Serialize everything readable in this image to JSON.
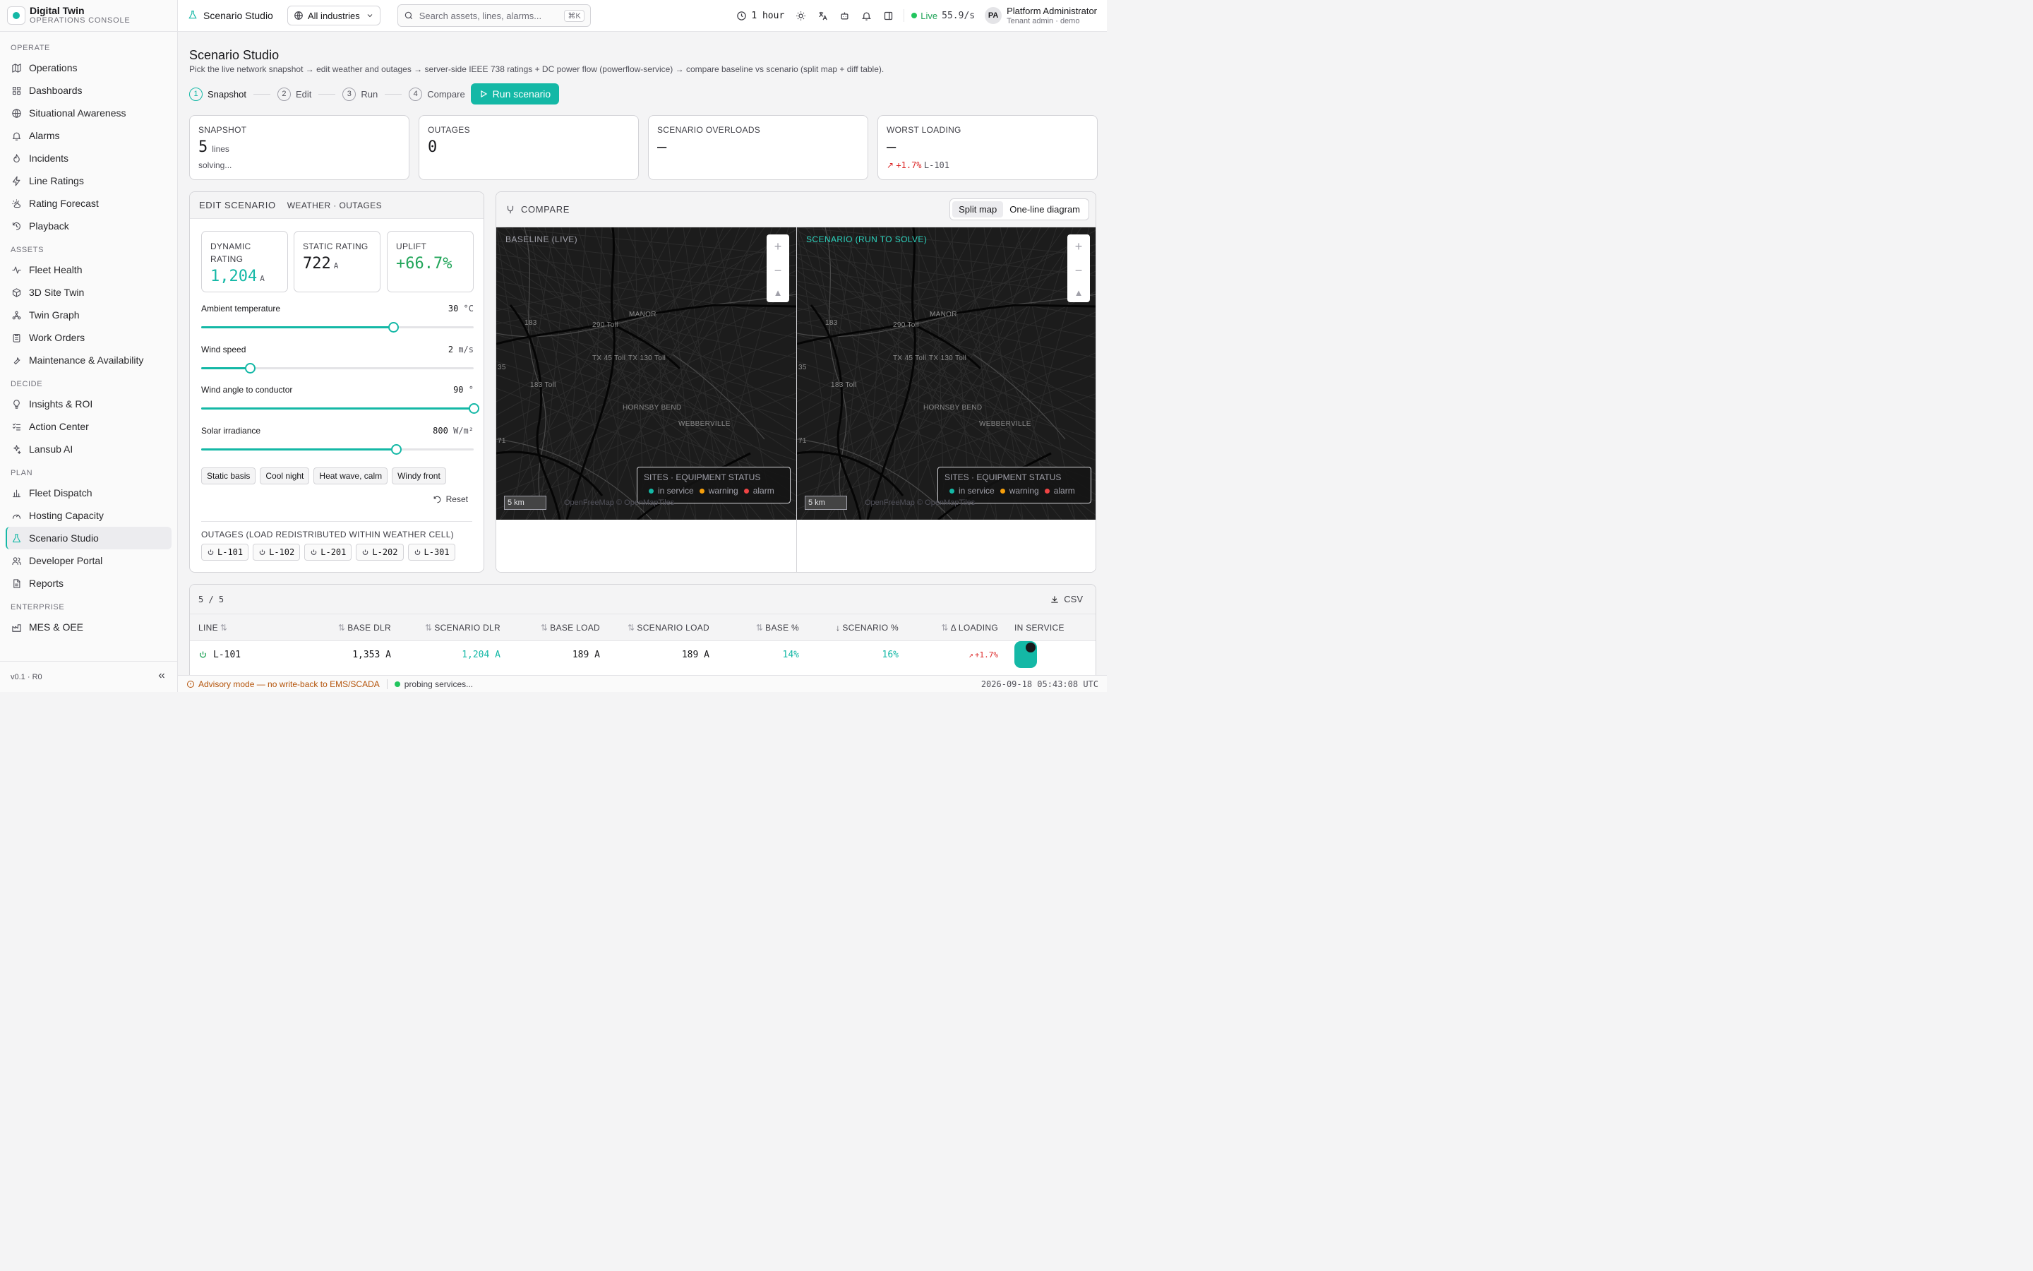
{
  "brand": {
    "title": "Digital Twin",
    "subtitle": "OPERATIONS CONSOLE"
  },
  "sidebar": {
    "sections": [
      {
        "label": "OPERATE",
        "items": [
          {
            "label": "Operations",
            "icon": "map-icon"
          },
          {
            "label": "Dashboards",
            "icon": "grid-icon"
          },
          {
            "label": "Situational Awareness",
            "icon": "globe-icon"
          },
          {
            "label": "Alarms",
            "icon": "bell-icon"
          },
          {
            "label": "Incidents",
            "icon": "flame-icon"
          },
          {
            "label": "Line Ratings",
            "icon": "zap-icon"
          },
          {
            "label": "Rating Forecast",
            "icon": "cloud-sun-icon"
          },
          {
            "label": "Playback",
            "icon": "history-icon"
          }
        ]
      },
      {
        "label": "ASSETS",
        "items": [
          {
            "label": "Fleet Health",
            "icon": "pulse-icon"
          },
          {
            "label": "3D Site Twin",
            "icon": "cube-icon"
          },
          {
            "label": "Twin Graph",
            "icon": "graph-icon"
          },
          {
            "label": "Work Orders",
            "icon": "clipboard-icon"
          },
          {
            "label": "Maintenance & Availability",
            "icon": "wrench-icon"
          }
        ]
      },
      {
        "label": "DECIDE",
        "items": [
          {
            "label": "Insights & ROI",
            "icon": "lightbulb-icon"
          },
          {
            "label": "Action Center",
            "icon": "checklist-icon"
          },
          {
            "label": "Lansub AI",
            "icon": "bot-icon"
          }
        ]
      },
      {
        "label": "PLAN",
        "items": [
          {
            "label": "Fleet Dispatch",
            "icon": "bar-chart-icon"
          },
          {
            "label": "Hosting Capacity",
            "icon": "gauge-icon"
          },
          {
            "label": "Scenario Studio",
            "icon": "flask-icon",
            "active": true
          },
          {
            "label": "Developer Portal",
            "icon": "users-icon"
          },
          {
            "label": "Reports",
            "icon": "file-icon"
          }
        ]
      },
      {
        "label": "ENTERPRISE",
        "items": [
          {
            "label": "MES & OEE",
            "icon": "factory-icon"
          }
        ]
      }
    ],
    "version": "v0.1 · R0",
    "collapse_icon": "chevrons-left-icon"
  },
  "topbar": {
    "page": "Scenario Studio",
    "industry": "All industries",
    "search_placeholder": "Search assets, lines, alarms...",
    "search_shortcut": "⌘K",
    "time_range": "1 hour",
    "live_label": "Live",
    "live_rate": "55.9/s",
    "user_initials": "PA",
    "user_name": "Platform Administrator",
    "user_role": "Tenant admin · demo"
  },
  "page": {
    "title": "Scenario Studio",
    "subtitle": "Pick the live network snapshot → edit weather and outages → server-side IEEE 738 ratings + DC power flow (powerflow-service) → compare baseline vs scenario (split map + diff table).",
    "steps": [
      {
        "n": "1",
        "label": "Snapshot",
        "active": true
      },
      {
        "n": "2",
        "label": "Edit"
      },
      {
        "n": "3",
        "label": "Run"
      },
      {
        "n": "4",
        "label": "Compare"
      }
    ],
    "run_label": "Run scenario"
  },
  "summary": {
    "snapshot": {
      "label": "SNAPSHOT",
      "value": "5",
      "unit": "lines",
      "status": "solving..."
    },
    "outages": {
      "label": "OUTAGES",
      "value": "0"
    },
    "overloads": {
      "label": "SCENARIO OVERLOADS",
      "value": "—"
    },
    "worst": {
      "label": "WORST LOADING",
      "value": "—",
      "delta": "+1.7%",
      "line": "L-101"
    }
  },
  "edit": {
    "title": "EDIT SCENARIO",
    "tabs": "WEATHER · OUTAGES",
    "dynamic": {
      "label": "DYNAMIC RATING",
      "value": "1,204",
      "unit": "A"
    },
    "static": {
      "label": "STATIC RATING",
      "value": "722",
      "unit": "A"
    },
    "uplift": {
      "label": "UPLIFT",
      "value": "+66.7%"
    },
    "sliders": [
      {
        "label": "Ambient temperature",
        "value": "30",
        "unit": "°C",
        "fraction": 0.705
      },
      {
        "label": "Wind speed",
        "value": "2",
        "unit": "m/s",
        "fraction": 0.18
      },
      {
        "label": "Wind angle to conductor",
        "value": "90",
        "unit": "°",
        "fraction": 1.0
      },
      {
        "label": "Solar irradiance",
        "value": "800",
        "unit": "W/m²",
        "fraction": 0.715
      }
    ],
    "presets": [
      "Static basis",
      "Cool night",
      "Heat wave, calm",
      "Windy front"
    ],
    "reset_label": "Reset",
    "outages_label": "OUTAGES (LOAD REDISTRIBUTED WITHIN WEATHER CELL)",
    "outage_lines": [
      "L-101",
      "L-102",
      "L-201",
      "L-202",
      "L-301"
    ]
  },
  "compare": {
    "title": "COMPARE",
    "view_split": "Split map",
    "view_oneline": "One-line diagram",
    "baseline_label": "BASELINE (LIVE)",
    "scenario_label": "SCENARIO (RUN TO SOLVE)",
    "legend_title": "SITES · EQUIPMENT STATUS",
    "legend": [
      {
        "label": "in service",
        "color": "#14b8a6"
      },
      {
        "label": "warning",
        "color": "#f59e0b"
      },
      {
        "label": "alarm",
        "color": "#ef4444"
      }
    ],
    "scale": "5 km",
    "attribution": "OpenFreeMap © OpenMapTiles",
    "places": [
      "MANOR",
      "290 Toll",
      "183",
      "TX 45 Toll",
      "TX 130 Toll",
      "183 Toll",
      "HORNSBY BEND",
      "WEBBERVILLE",
      "35",
      "71"
    ]
  },
  "table": {
    "count": "5 / 5",
    "csv_label": "CSV",
    "columns": [
      "LINE",
      "BASE DLR",
      "SCENARIO DLR",
      "BASE LOAD",
      "SCENARIO LOAD",
      "BASE %",
      "SCENARIO %",
      "Δ LOADING",
      "IN SERVICE"
    ],
    "rows": [
      {
        "line": "L-101",
        "base_dlr": "1,353 A",
        "scn_dlr": "1,204 A",
        "base_load": "189 A",
        "scn_load": "189 A",
        "base_pct": "14%",
        "scn_pct": "16%",
        "delta": "+1.7%",
        "in_service": true
      }
    ]
  },
  "status": {
    "advisory": "Advisory mode — no write-back to EMS/SCADA",
    "probe": "probing services...",
    "clock": "2026-09-18 05:43:08 UTC"
  }
}
